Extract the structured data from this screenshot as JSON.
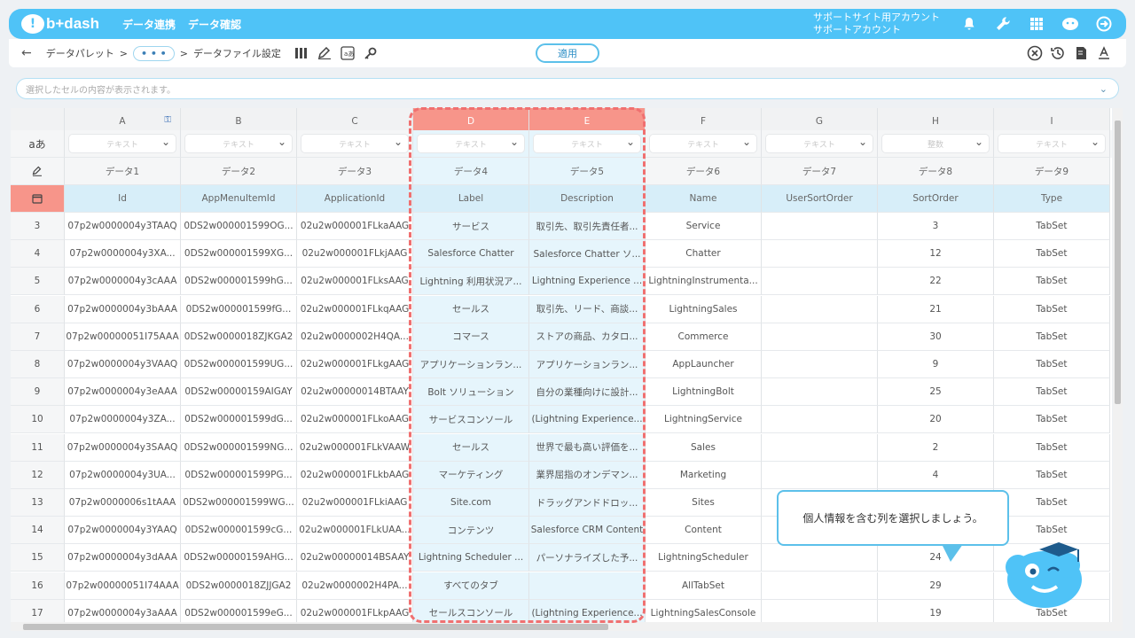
{
  "header": {
    "logo": "b+dash",
    "nav": [
      "データ連携",
      "データ確認"
    ],
    "account_line1": "サポートサイト用アカウント",
    "account_line2": "サポートアカウント"
  },
  "toolbar": {
    "crumb1": "データパレット",
    "ellipsis": "• • •",
    "crumb2": "データファイル設定",
    "apply": "適用"
  },
  "cellbar": {
    "placeholder": "選択したセルの内容が表示されます。"
  },
  "grid": {
    "columns": [
      "A",
      "B",
      "C",
      "D",
      "E",
      "F",
      "G",
      "H",
      "I"
    ],
    "type_row_label": "aあ",
    "types": [
      "テキスト",
      "テキスト",
      "テキスト",
      "テキスト",
      "テキスト",
      "テキスト",
      "テキスト",
      "整数",
      "テキスト"
    ],
    "data_names": [
      "データ1",
      "データ2",
      "データ3",
      "データ4",
      "データ5",
      "データ6",
      "データ7",
      "データ8",
      "データ9"
    ],
    "fields": [
      "Id",
      "AppMenuItemId",
      "ApplicationId",
      "Label",
      "Description",
      "Name",
      "UserSortOrder",
      "SortOrder",
      "Type"
    ],
    "rows": [
      {
        "n": "3",
        "cells": [
          "07p2w0000004y3TAAQ",
          "0DS2w000001599OG...",
          "02u2w000001FLkaAAG",
          "サービス",
          "取引先、取引先責任者...",
          "Service",
          "",
          "3",
          "TabSet"
        ]
      },
      {
        "n": "4",
        "cells": [
          "07p2w0000004y3XA...",
          "0DS2w000001599XG...",
          "02u2w000001FLkjAAG",
          "Salesforce Chatter",
          "Salesforce Chatter ソ...",
          "Chatter",
          "",
          "12",
          "TabSet"
        ]
      },
      {
        "n": "5",
        "cells": [
          "07p2w0000004y3cAAA",
          "0DS2w000001599hG...",
          "02u2w000001FLksAAG",
          "Lightning 利用状況ア...",
          "Lightning Experience ...",
          "LightningInstrumenta...",
          "",
          "22",
          "TabSet"
        ]
      },
      {
        "n": "6",
        "cells": [
          "07p2w0000004y3bAAA",
          "0DS2w000001599fG...",
          "02u2w000001FLkqAAG",
          "セールス",
          "取引先、リード、商談...",
          "LightningSales",
          "",
          "21",
          "TabSet"
        ]
      },
      {
        "n": "7",
        "cells": [
          "07p2w00000051I75AAA",
          "0DS2w0000018ZJKGA2",
          "02u2w0000002H4QA...",
          "コマース",
          "ストアの商品、カタロ...",
          "Commerce",
          "",
          "30",
          "TabSet"
        ]
      },
      {
        "n": "8",
        "cells": [
          "07p2w0000004y3VAAQ",
          "0DS2w000001599UG...",
          "02u2w000001FLkgAAG",
          "アプリケーションラン...",
          "アプリケーションラン...",
          "AppLauncher",
          "",
          "9",
          "TabSet"
        ]
      },
      {
        "n": "9",
        "cells": [
          "07p2w0000004y3eAAA",
          "0DS2w00000159AIGAY",
          "02u2w00000014BTAAY",
          "Bolt ソリューション",
          "自分の業種向けに設計...",
          "LightningBolt",
          "",
          "25",
          "TabSet"
        ]
      },
      {
        "n": "10",
        "cells": [
          "07p2w0000004y3ZA...",
          "0DS2w000001599dG...",
          "02u2w000001FLkoAAG",
          "サービスコンソール",
          "(Lightning Experience...",
          "LightningService",
          "",
          "20",
          "TabSet"
        ]
      },
      {
        "n": "11",
        "cells": [
          "07p2w0000004y3SAAQ",
          "0DS2w000001599NG...",
          "02u2w000001FLkVAAW",
          "セールス",
          "世界で最も高い評価を...",
          "Sales",
          "",
          "2",
          "TabSet"
        ]
      },
      {
        "n": "12",
        "cells": [
          "07p2w0000004y3UA...",
          "0DS2w000001599PG...",
          "02u2w000001FLkbAAG",
          "マーケティング",
          "業界屈指のオンデマン...",
          "Marketing",
          "",
          "4",
          "TabSet"
        ]
      },
      {
        "n": "13",
        "cells": [
          "07p2w0000006s1tAAA",
          "0DS2w000001599WG...",
          "02u2w000001FLkiAAG",
          "Site.com",
          "ドラッグアンドドロッ...",
          "Sites",
          "",
          "",
          "TabSet"
        ]
      },
      {
        "n": "14",
        "cells": [
          "07p2w0000004y3YAAQ",
          "0DS2w000001599cG...",
          "02u2w000001FLkUAA...",
          "コンテンツ",
          "Salesforce CRM Content",
          "Content",
          "",
          "",
          "TabSet"
        ]
      },
      {
        "n": "15",
        "cells": [
          "07p2w0000004y3dAAA",
          "0DS2w00000159AHG...",
          "02u2w00000014BSAAY",
          "Lightning Scheduler ...",
          "パーソナライズした予...",
          "LightningScheduler",
          "",
          "24",
          ""
        ]
      },
      {
        "n": "16",
        "cells": [
          "07p2w00000051I74AAA",
          "0DS2w0000018ZJJGA2",
          "02u2w0000002H4PA...",
          "すべてのタブ",
          "",
          "AllTabSet",
          "",
          "29",
          ""
        ]
      },
      {
        "n": "17",
        "cells": [
          "07p2w0000004y3aAAA",
          "0DS2w000001599eG...",
          "02u2w000001FLkpAAG",
          "セールスコンソール",
          "(Lightning Experience...",
          "LightningSalesConsole",
          "",
          "19",
          "TabSet"
        ]
      }
    ]
  },
  "tooltip": {
    "text": "個人情報を含む列を選択しましょう。"
  },
  "colors": {
    "accent": "#4fc3f7",
    "selected_header": "#f7958a",
    "dash": "#f07070"
  }
}
